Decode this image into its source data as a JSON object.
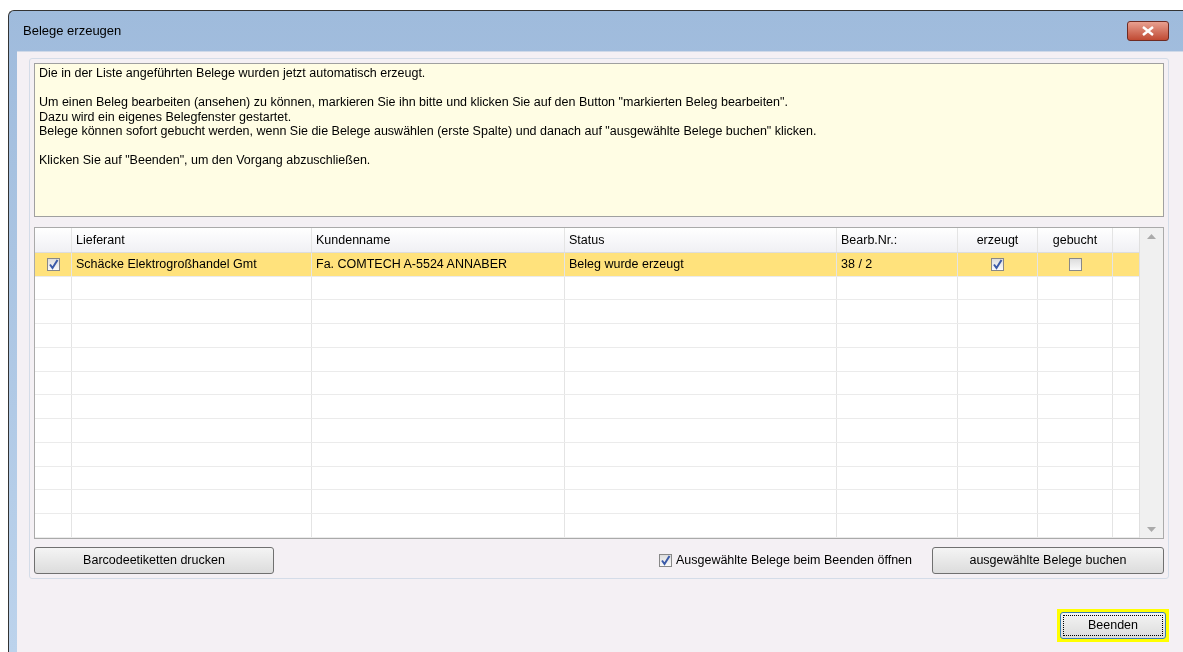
{
  "window": {
    "title": "Belege erzeugen"
  },
  "info_paragraphs": [
    [
      "Die in der Liste angeführten Belege wurden jetzt automatisch erzeugt."
    ],
    [
      "Um einen Beleg bearbeiten (ansehen) zu können, markieren Sie ihn bitte und klicken Sie auf den Button \"markierten Beleg bearbeiten\".",
      "Dazu wird ein eigenes Belegfenster gestartet.",
      "Belege können sofort gebucht werden, wenn Sie die Belege auswählen (erste Spalte) und danach auf \"ausgewählte Belege buchen\" klicken."
    ],
    [
      "Klicken Sie auf \"Beenden\", um den Vorgang abzuschließen."
    ]
  ],
  "table": {
    "columns": [
      "Lieferant",
      "Kundenname",
      "Status",
      "Bearb.Nr.:",
      "erzeugt",
      "gebucht"
    ],
    "rows": [
      {
        "checked": true,
        "selected": true,
        "lieferant": "Schäcke Elektrogroßhandel Gmt",
        "kundenname": "Fa. COMTECH A-5524 ANNABER",
        "status": "Beleg wurde erzeugt",
        "bearb_nr": "38 / 2",
        "erzeugt": true,
        "gebucht": false
      }
    ]
  },
  "barcode_button": "Barcodeetiketten drucken",
  "open_checkbox": {
    "label": "Ausgewählte Belege beim Beenden öffnen",
    "checked": true
  },
  "book_button": "ausgewählte Belege buchen",
  "finish_button": {
    "label": "Beenden",
    "highlighted": true
  }
}
